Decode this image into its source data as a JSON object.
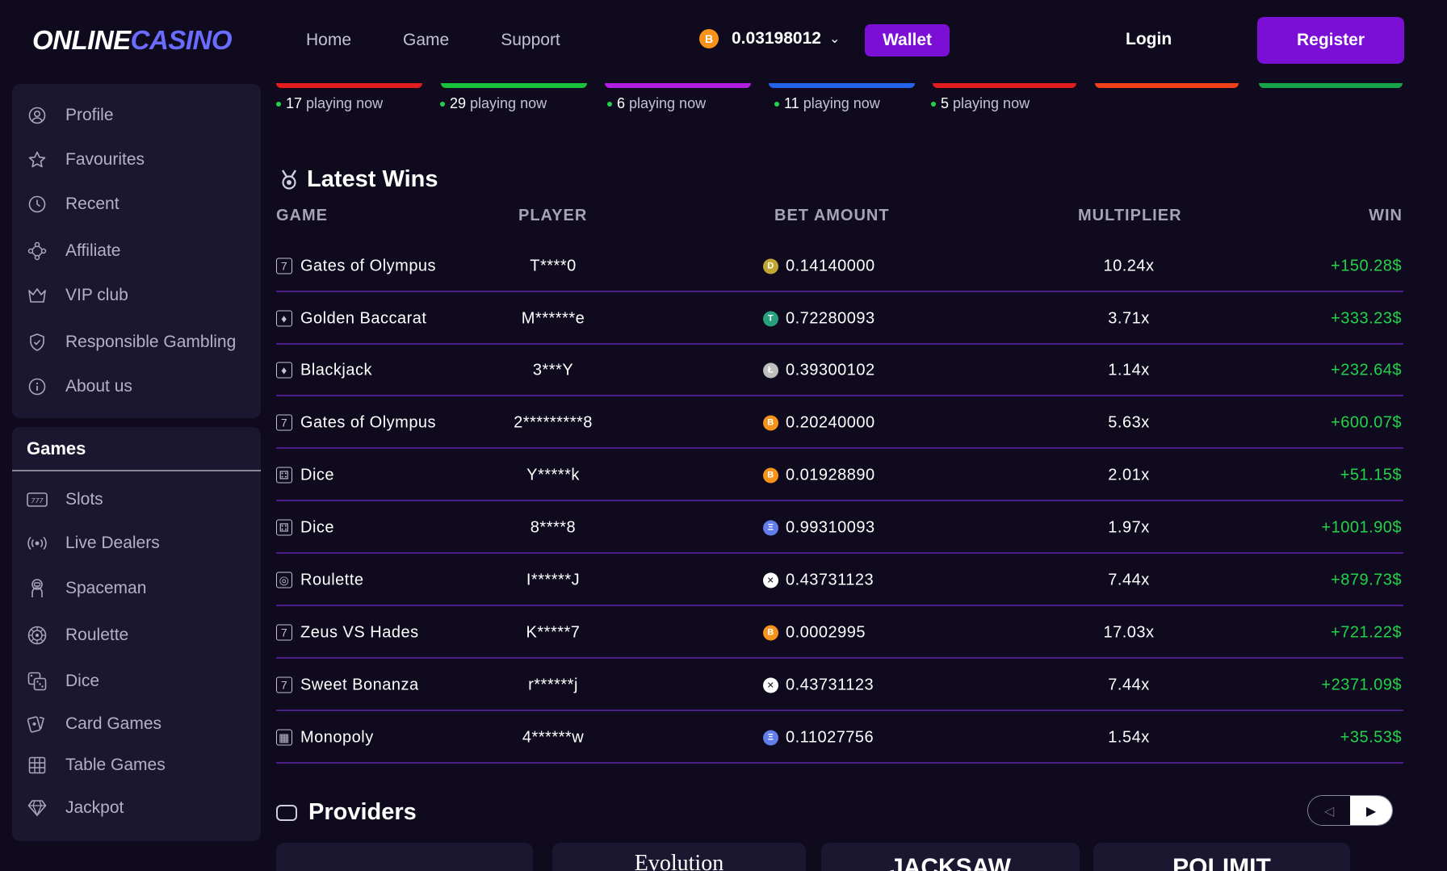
{
  "header": {
    "logo_part1": "ONLINE",
    "logo_part2": "CASINO",
    "nav": [
      "Home",
      "Game",
      "Support"
    ],
    "balance": "0.03198012",
    "balance_coin": "B",
    "wallet_label": "Wallet",
    "login_label": "Login",
    "register_label": "Register"
  },
  "sidebar": {
    "items": [
      {
        "label": "Profile",
        "icon": "user-circle-icon"
      },
      {
        "label": "Favourites",
        "icon": "star-icon"
      },
      {
        "label": "Recent",
        "icon": "clock-icon"
      },
      {
        "label": "Affiliate",
        "icon": "network-icon"
      },
      {
        "label": "VIP club",
        "icon": "crown-icon"
      },
      {
        "label": "Responsible Gambling",
        "icon": "shield-check-icon"
      },
      {
        "label": "About us",
        "icon": "info-icon"
      }
    ],
    "games_title": "Games",
    "games": [
      {
        "label": "Slots",
        "icon": "slots-icon"
      },
      {
        "label": "Live Dealers",
        "icon": "broadcast-icon"
      },
      {
        "label": "Spaceman",
        "icon": "astronaut-icon"
      },
      {
        "label": "Roulette",
        "icon": "roulette-icon"
      },
      {
        "label": "Dice",
        "icon": "dice-icon"
      },
      {
        "label": "Card Games",
        "icon": "cards-icon"
      },
      {
        "label": "Table Games",
        "icon": "table-grid-icon"
      },
      {
        "label": "Jackpot",
        "icon": "diamond-icon"
      }
    ]
  },
  "game_strip": {
    "bar_colors": [
      "#e11d1d",
      "#19c23a",
      "#b01ee0",
      "#2563eb",
      "#e11d1d",
      "#f0401a",
      "#16a34a"
    ],
    "playing_suffix": "playing now",
    "playing": [
      "17",
      "29",
      "6",
      "11",
      "5"
    ]
  },
  "latest_wins": {
    "title": "Latest Wins",
    "headers": {
      "game": "GAME",
      "player": "PLAYER",
      "bet": "BET AMOUNT",
      "multiplier": "MULTIPLIER",
      "win": "WIN"
    },
    "rows": [
      {
        "game": "Gates of Olympus",
        "game_icon": "slots-icon",
        "player": "T****0",
        "coin": "D",
        "coin_color": "#c2a633",
        "bet": "0.14140000",
        "multiplier": "10.24x",
        "win": "+150.28$"
      },
      {
        "game": "Golden Baccarat",
        "game_icon": "cards-icon",
        "player": "M******e",
        "coin": "T",
        "coin_color": "#26a17b",
        "bet": "0.72280093",
        "multiplier": "3.71x",
        "win": "+333.23$"
      },
      {
        "game": "Blackjack",
        "game_icon": "cards-icon",
        "player": "3***Y",
        "coin": "Ł",
        "coin_color": "#bebebe",
        "bet": "0.39300102",
        "multiplier": "1.14x",
        "win": "+232.64$"
      },
      {
        "game": "Gates of Olympus",
        "game_icon": "slots-icon",
        "player": "2*********8",
        "coin": "B",
        "coin_color": "#f7931a",
        "bet": "0.20240000",
        "multiplier": "5.63x",
        "win": "+600.07$"
      },
      {
        "game": "Dice",
        "game_icon": "dice-icon",
        "player": "Y*****k",
        "coin": "B",
        "coin_color": "#f7931a",
        "bet": "0.01928890",
        "multiplier": "2.01x",
        "win": "+51.15$"
      },
      {
        "game": "Dice",
        "game_icon": "dice-icon",
        "player": "8****8",
        "coin": "Ξ",
        "coin_color": "#627eea",
        "bet": "0.99310093",
        "multiplier": "1.97x",
        "win": "+1001.90$"
      },
      {
        "game": "Roulette",
        "game_icon": "roulette-icon",
        "player": "I******J",
        "coin": "✕",
        "coin_color": "#ffffff",
        "bet": "0.43731123",
        "multiplier": "7.44x",
        "win": "+879.73$"
      },
      {
        "game": "Zeus VS Hades",
        "game_icon": "slots-icon",
        "player": "K*****7",
        "coin": "B",
        "coin_color": "#f7931a",
        "bet": "0.0002995",
        "multiplier": "17.03x",
        "win": "+721.22$"
      },
      {
        "game": "Sweet Bonanza",
        "game_icon": "slots-icon",
        "player": "r******j",
        "coin": "✕",
        "coin_color": "#ffffff",
        "bet": "0.43731123",
        "multiplier": "7.44x",
        "win": "+2371.09$"
      },
      {
        "game": "Monopoly",
        "game_icon": "table-grid-icon",
        "player": "4******w",
        "coin": "Ξ",
        "coin_color": "#627eea",
        "bet": "0.11027756",
        "multiplier": "1.54x",
        "win": "+35.53$"
      }
    ]
  },
  "providers": {
    "title": "Providers",
    "prev_label": "◁",
    "next_label": "▶",
    "cards": [
      "",
      "Evolution",
      "JACKSAW",
      "POLIMIT"
    ]
  },
  "colors": {
    "background": "#0f0a1e",
    "panel": "#1c1730",
    "accent": "#7b0fd6",
    "logo_accent": "#6a6cff",
    "win_green": "#22d34a",
    "row_separator": "#4a1e8a"
  }
}
